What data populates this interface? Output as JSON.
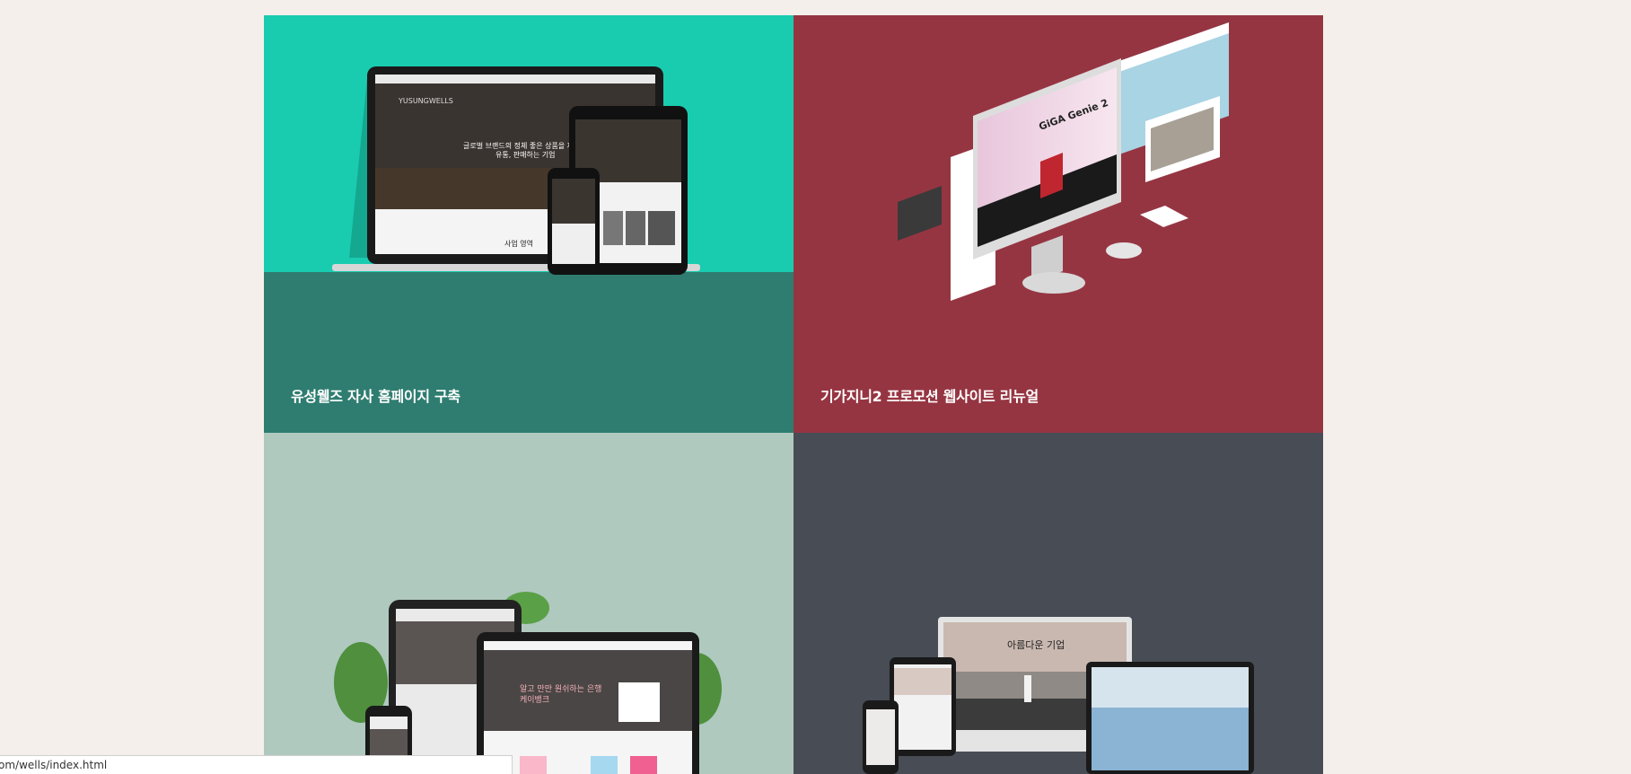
{
  "portfolio": {
    "items": [
      {
        "title": "유성웰즈 자사 홈페이지 구축",
        "accent": "#19ccb0",
        "base": "#2e7d70"
      },
      {
        "title": "기가지니2 프로모션 웹사이트 리뉴얼",
        "accent": "#963542"
      },
      {
        "title": "",
        "accent": "#afc9bf"
      },
      {
        "title": "",
        "accent": "#474c55"
      }
    ],
    "mockup_texts": {
      "card1_brand": "YUSUNGWELLS",
      "card1_headline_1": "글로벌 브랜드의 정체 좋은 상품을 제수입하여",
      "card1_headline_2": "유통, 판매하는 기업",
      "card1_section": "사업 영역",
      "card2_product": "GiGA Genie 2",
      "card3_headline_1": "알고 만만 원쉬하는 은행",
      "card3_headline_2": "케이뱅크",
      "card4_headline": "아름다운 기업"
    }
  },
  "status_bar": {
    "url": "om/wells/index.html"
  }
}
